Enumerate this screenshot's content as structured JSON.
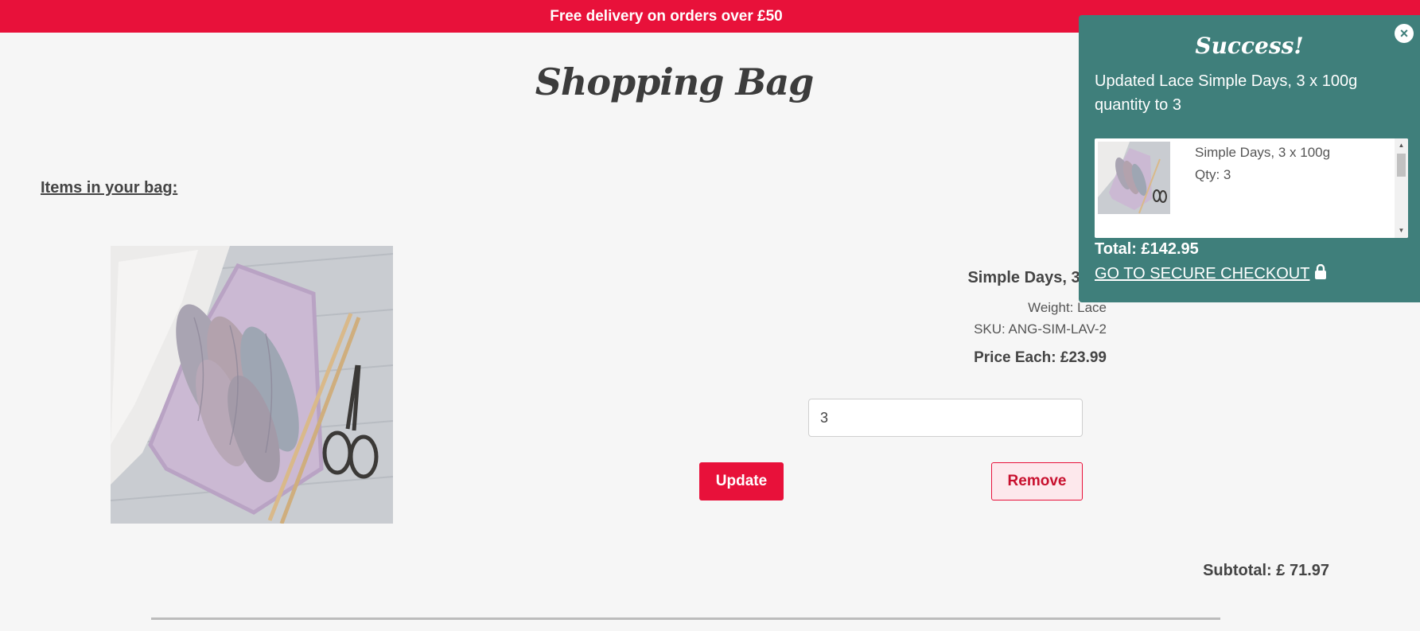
{
  "promo": {
    "text": "Free delivery on orders over £50"
  },
  "page": {
    "title": "Shopping Bag",
    "section_heading": "Items in your bag:"
  },
  "bag_item": {
    "name": "Simple Days, 3 x 1",
    "weight": "Weight: Lace",
    "sku": "SKU: ANG-SIM-LAV-2",
    "price_each": "Price Each: £23.99",
    "quantity_value": "3",
    "update_label": "Update",
    "remove_label": "Remove",
    "image_icon": "product-photo-yarn-skeins"
  },
  "subtotal": "Subtotal: £ 71.97",
  "toast": {
    "close_glyph": "×",
    "title": "Success!",
    "message": "Updated Lace Simple Days, 3 x 100g quantity to 3",
    "item_name": "Simple Days, 3 x 100g",
    "item_qty": "Qty: 3",
    "total": "Total: £142.95",
    "checkout_label": "GO TO SECURE CHECKOUT",
    "bg_color": "#3f7f7b"
  },
  "colors": {
    "brand": "#e8113a",
    "background": "#f6f6f6"
  }
}
